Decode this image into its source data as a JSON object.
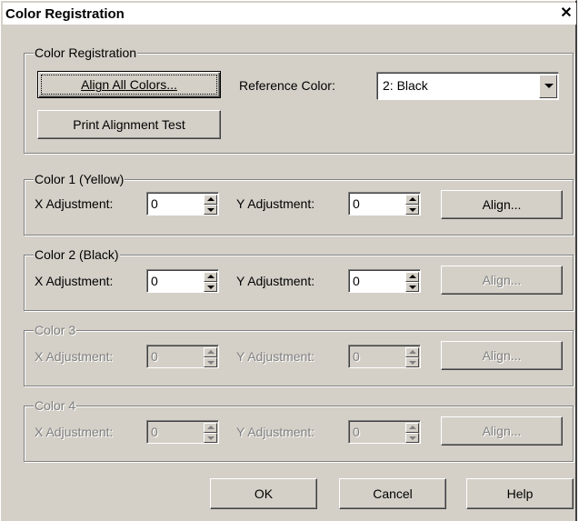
{
  "window": {
    "title": "Color Registration",
    "close_glyph": "✕"
  },
  "registration": {
    "legend": "Color Registration",
    "align_all_label": "Align All Colors...",
    "print_test_label": "Print Alignment Test",
    "reference_label": "Reference Color:",
    "reference_value": "2: Black"
  },
  "colors": [
    {
      "legend": "Color 1 (Yellow)",
      "x_label": "X Adjustment:",
      "x_value": "0",
      "y_label": "Y Adjustment:",
      "y_value": "0",
      "align_label": "Align...",
      "enabled": true,
      "align_enabled": true
    },
    {
      "legend": "Color 2 (Black)",
      "x_label": "X Adjustment:",
      "x_value": "0",
      "y_label": "Y Adjustment:",
      "y_value": "0",
      "align_label": "Align...",
      "enabled": true,
      "align_enabled": false
    },
    {
      "legend": "Color 3",
      "x_label": "X Adjustment:",
      "x_value": "0",
      "y_label": "Y Adjustment:",
      "y_value": "0",
      "align_label": "Align...",
      "enabled": false,
      "align_enabled": false
    },
    {
      "legend": "Color 4",
      "x_label": "X Adjustment:",
      "x_value": "0",
      "y_label": "Y Adjustment:",
      "y_value": "0",
      "align_label": "Align...",
      "enabled": false,
      "align_enabled": false
    }
  ],
  "footer": {
    "ok_label": "OK",
    "cancel_label": "Cancel",
    "help_label": "Help"
  },
  "colors_palette": {
    "face": "#d4d0c8",
    "shadow": "#808080",
    "highlight": "#ffffff",
    "dark": "#404040"
  }
}
